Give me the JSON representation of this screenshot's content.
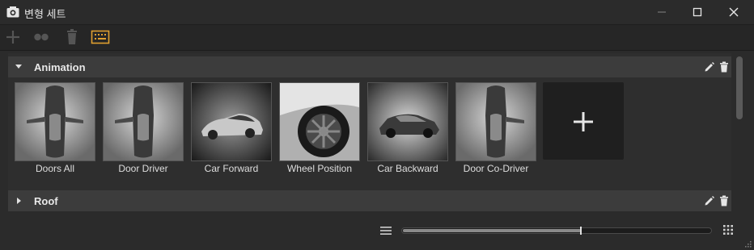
{
  "window": {
    "title": "변형 세트"
  },
  "toolbar": {
    "buttons": [
      {
        "icon": "plus-icon",
        "label": ""
      },
      {
        "icon": "link-dots-icon",
        "label": ""
      },
      {
        "icon": "trash-icon",
        "label": ""
      },
      {
        "icon": "keyboard-shortcut-icon",
        "label": ""
      }
    ]
  },
  "groups": [
    {
      "name": "Animation",
      "expanded": true,
      "items": [
        {
          "label": "Doors All"
        },
        {
          "label": "Door Driver"
        },
        {
          "label": "Car Forward"
        },
        {
          "label": "Wheel Position"
        },
        {
          "label": "Car Backward"
        },
        {
          "label": "Door Co-Driver"
        }
      ]
    },
    {
      "name": "Roof",
      "expanded": false,
      "items": []
    }
  ],
  "zoom": {
    "level": 0.58
  },
  "colors": {
    "accent": "#e0a030",
    "panel": "#2e2e2e",
    "header": "#3c3c3c"
  }
}
